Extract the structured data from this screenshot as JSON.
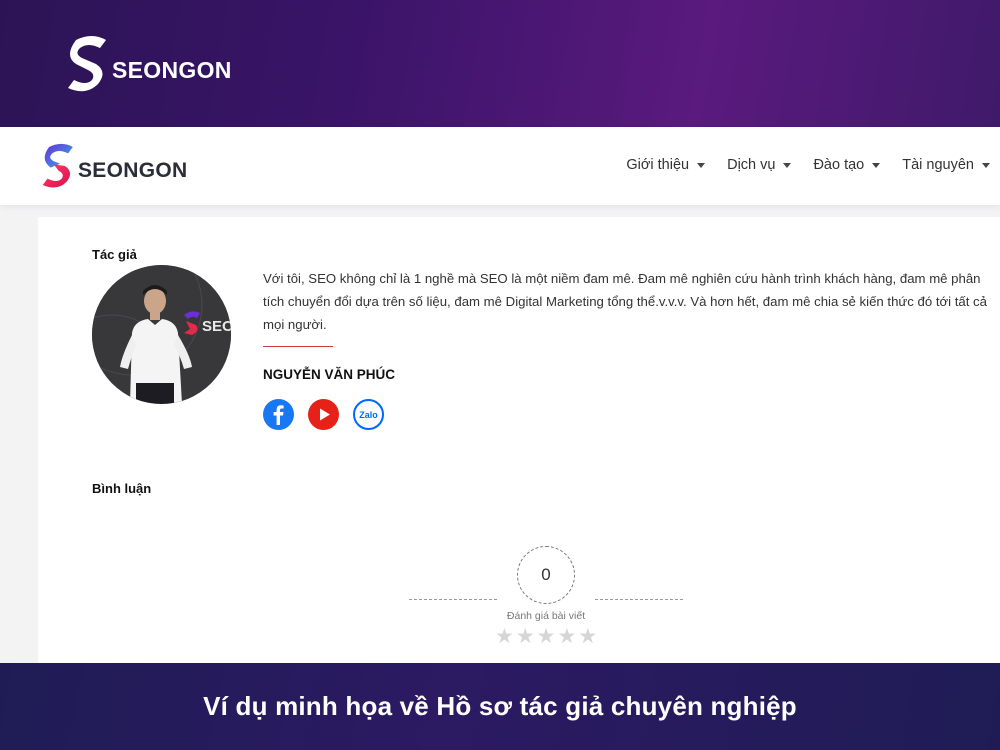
{
  "banner": {
    "logo_text": "SEONGON"
  },
  "site": {
    "logo_text": "SEONGON",
    "nav": [
      {
        "label": "Giới thiệu"
      },
      {
        "label": "Dịch vụ"
      },
      {
        "label": "Đào tạo"
      },
      {
        "label": "Tài nguyên"
      }
    ]
  },
  "author": {
    "heading": "Tác giả",
    "bio": "Với tôi, SEO không chỉ là 1 nghề mà SEO là một niềm đam mê. Đam mê nghiên cứu hành trình khách hàng, đam mê phân tích chuyển đổi dựa trên số liệu, đam mê Digital Marketing tổng thể.v.v.v. Và hơn hết, đam mê chia sẻ kiến thức đó tới tất cả mọi người.",
    "name": "NGUYỄN VĂN PHÚC",
    "photo_text": "SEO",
    "socials": [
      {
        "icon": "facebook-icon"
      },
      {
        "icon": "youtube-icon"
      },
      {
        "icon": "zalo-icon",
        "label": "Zalo"
      }
    ]
  },
  "comments": {
    "heading": "Bình luận",
    "score": "0",
    "rating_label": "Đánh giá bài viết",
    "stars_filled": 0,
    "stars_total": 5
  },
  "caption": "Ví dụ minh họa về Hồ sơ tác giả chuyên nghiệp",
  "colors": {
    "banner_top": "#3a1468",
    "banner_bottom": "#25195b",
    "brand_red": "#e32a4b",
    "brand_purple": "#6b2fd6"
  }
}
